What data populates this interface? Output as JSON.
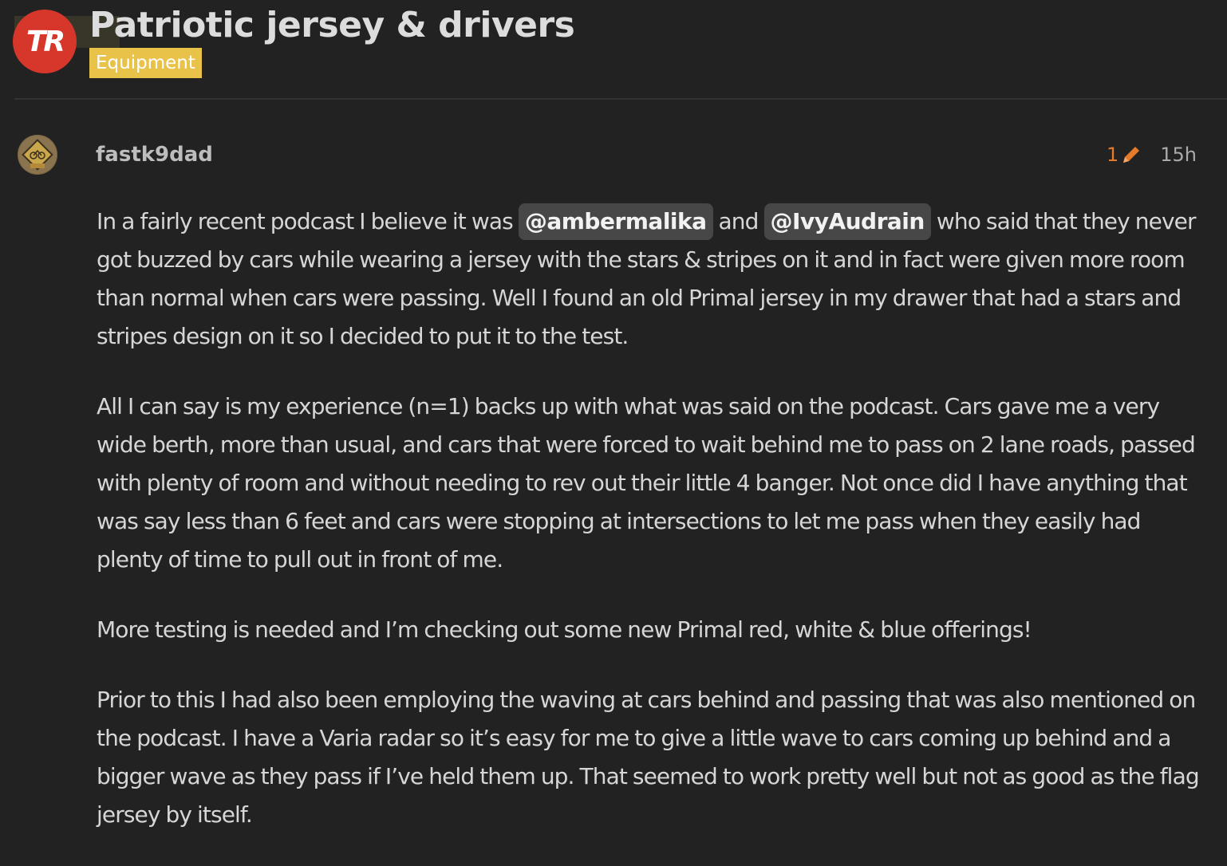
{
  "site": {
    "logo_text": "TR"
  },
  "topic": {
    "title": "Patriotic jersey & drivers",
    "category": "Equipment",
    "category_color": "#e9c24a"
  },
  "post": {
    "username": "fastk9dad",
    "edit_count": "1",
    "time": "15h",
    "p1_pre": "In a fairly recent podcast I believe it was ",
    "mention1": "@ambermalika",
    "p1_mid": " and ",
    "mention2": "@IvyAudrain",
    "p1_post": " who said that they never got buzzed by cars while wearing a jersey with the stars & stripes on it and in fact were given more room than normal when cars were passing. Well I found an old Primal jersey in my drawer that had a stars and stripes design on it so I decided to put it to the test.",
    "p2": "All I can say is my experience (n=1) backs up with what was said on the podcast. Cars gave me a very wide berth, more than usual, and cars that were forced to wait behind me to pass on 2 lane roads, passed with plenty of room and without needing to rev out their little 4 banger. Not once did I have anything that was say less than 6 feet and cars were stopping at intersections to let me pass when they easily had plenty of time to pull out in front of me.",
    "p3": "More testing is needed and I’m checking out some new Primal red, white & blue offerings!",
    "p4": "Prior to this I had also been employing the waving at cars behind and passing that was also mentioned on the podcast. I have a Varia radar so it’s easy for me to give a little wave to cars coming up behind and a bigger wave as they pass if I’ve held them up. That seemed to work pretty well but not as good as the flag jersey by itself."
  },
  "icons": {
    "edit": "pencil-icon",
    "logo": "trainerroad-logo"
  },
  "colors": {
    "background": "#222222",
    "logo_red": "#d7372a",
    "edit_orange": "#e57a2b",
    "mention_bg": "#474747"
  }
}
